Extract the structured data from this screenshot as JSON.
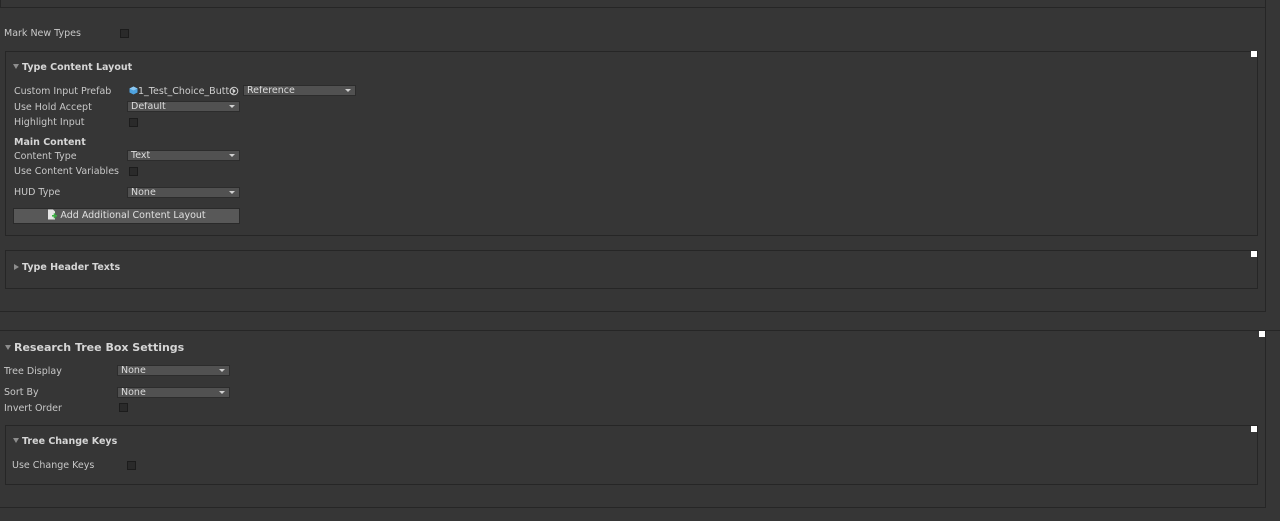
{
  "top_section": {
    "mark_new_types_label": "Mark New Types"
  },
  "type_content_layout": {
    "title": "Type Content Layout",
    "custom_input_prefab_label": "Custom Input Prefab",
    "custom_input_prefab_value": "1_Test_Choice_Butto",
    "reference_dropdown": "Reference",
    "use_hold_accept_label": "Use Hold Accept",
    "use_hold_accept_value": "Default",
    "highlight_input_label": "Highlight Input",
    "main_content_heading": "Main Content",
    "content_type_label": "Content Type",
    "content_type_value": "Text",
    "use_content_variables_label": "Use Content Variables",
    "hud_type_label": "HUD Type",
    "hud_type_value": "None",
    "add_layout_button": "Add Additional Content Layout"
  },
  "type_header_texts": {
    "title": "Type Header Texts"
  },
  "research_tree_box_settings": {
    "title": "Research Tree Box Settings",
    "tree_display_label": "Tree Display",
    "tree_display_value": "None",
    "sort_by_label": "Sort By",
    "sort_by_value": "None",
    "invert_order_label": "Invert Order"
  },
  "tree_change_keys": {
    "title": "Tree Change Keys",
    "use_change_keys_label": "Use Change Keys"
  },
  "icons": {
    "prefab_icon": "prefab-cube-icon",
    "object_picker": "object-picker-icon",
    "add_icon": "add-document-icon"
  }
}
